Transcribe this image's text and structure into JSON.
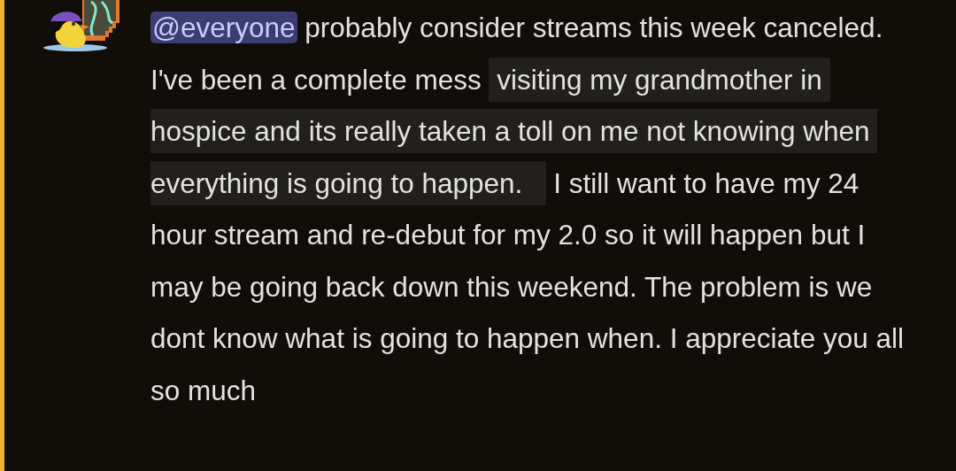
{
  "message": {
    "highlighted": true,
    "segments": [
      {
        "kind": "mention",
        "text": "@everyone"
      },
      {
        "kind": "text",
        "text": " probably consider streams this week canceled. I've been a complete mess "
      },
      {
        "kind": "spoiler",
        "text": " visiting my grandmother in hospice and its really taken a toll on me not knowing when everything is going to happen.   "
      },
      {
        "kind": "text",
        "text": " I still want to have my 24 hour stream and re-debut for my 2.0 so it will happen but I may be going back down this weekend. The problem is we dont know what is going to happen when. I appreciate you all so much"
      }
    ]
  }
}
